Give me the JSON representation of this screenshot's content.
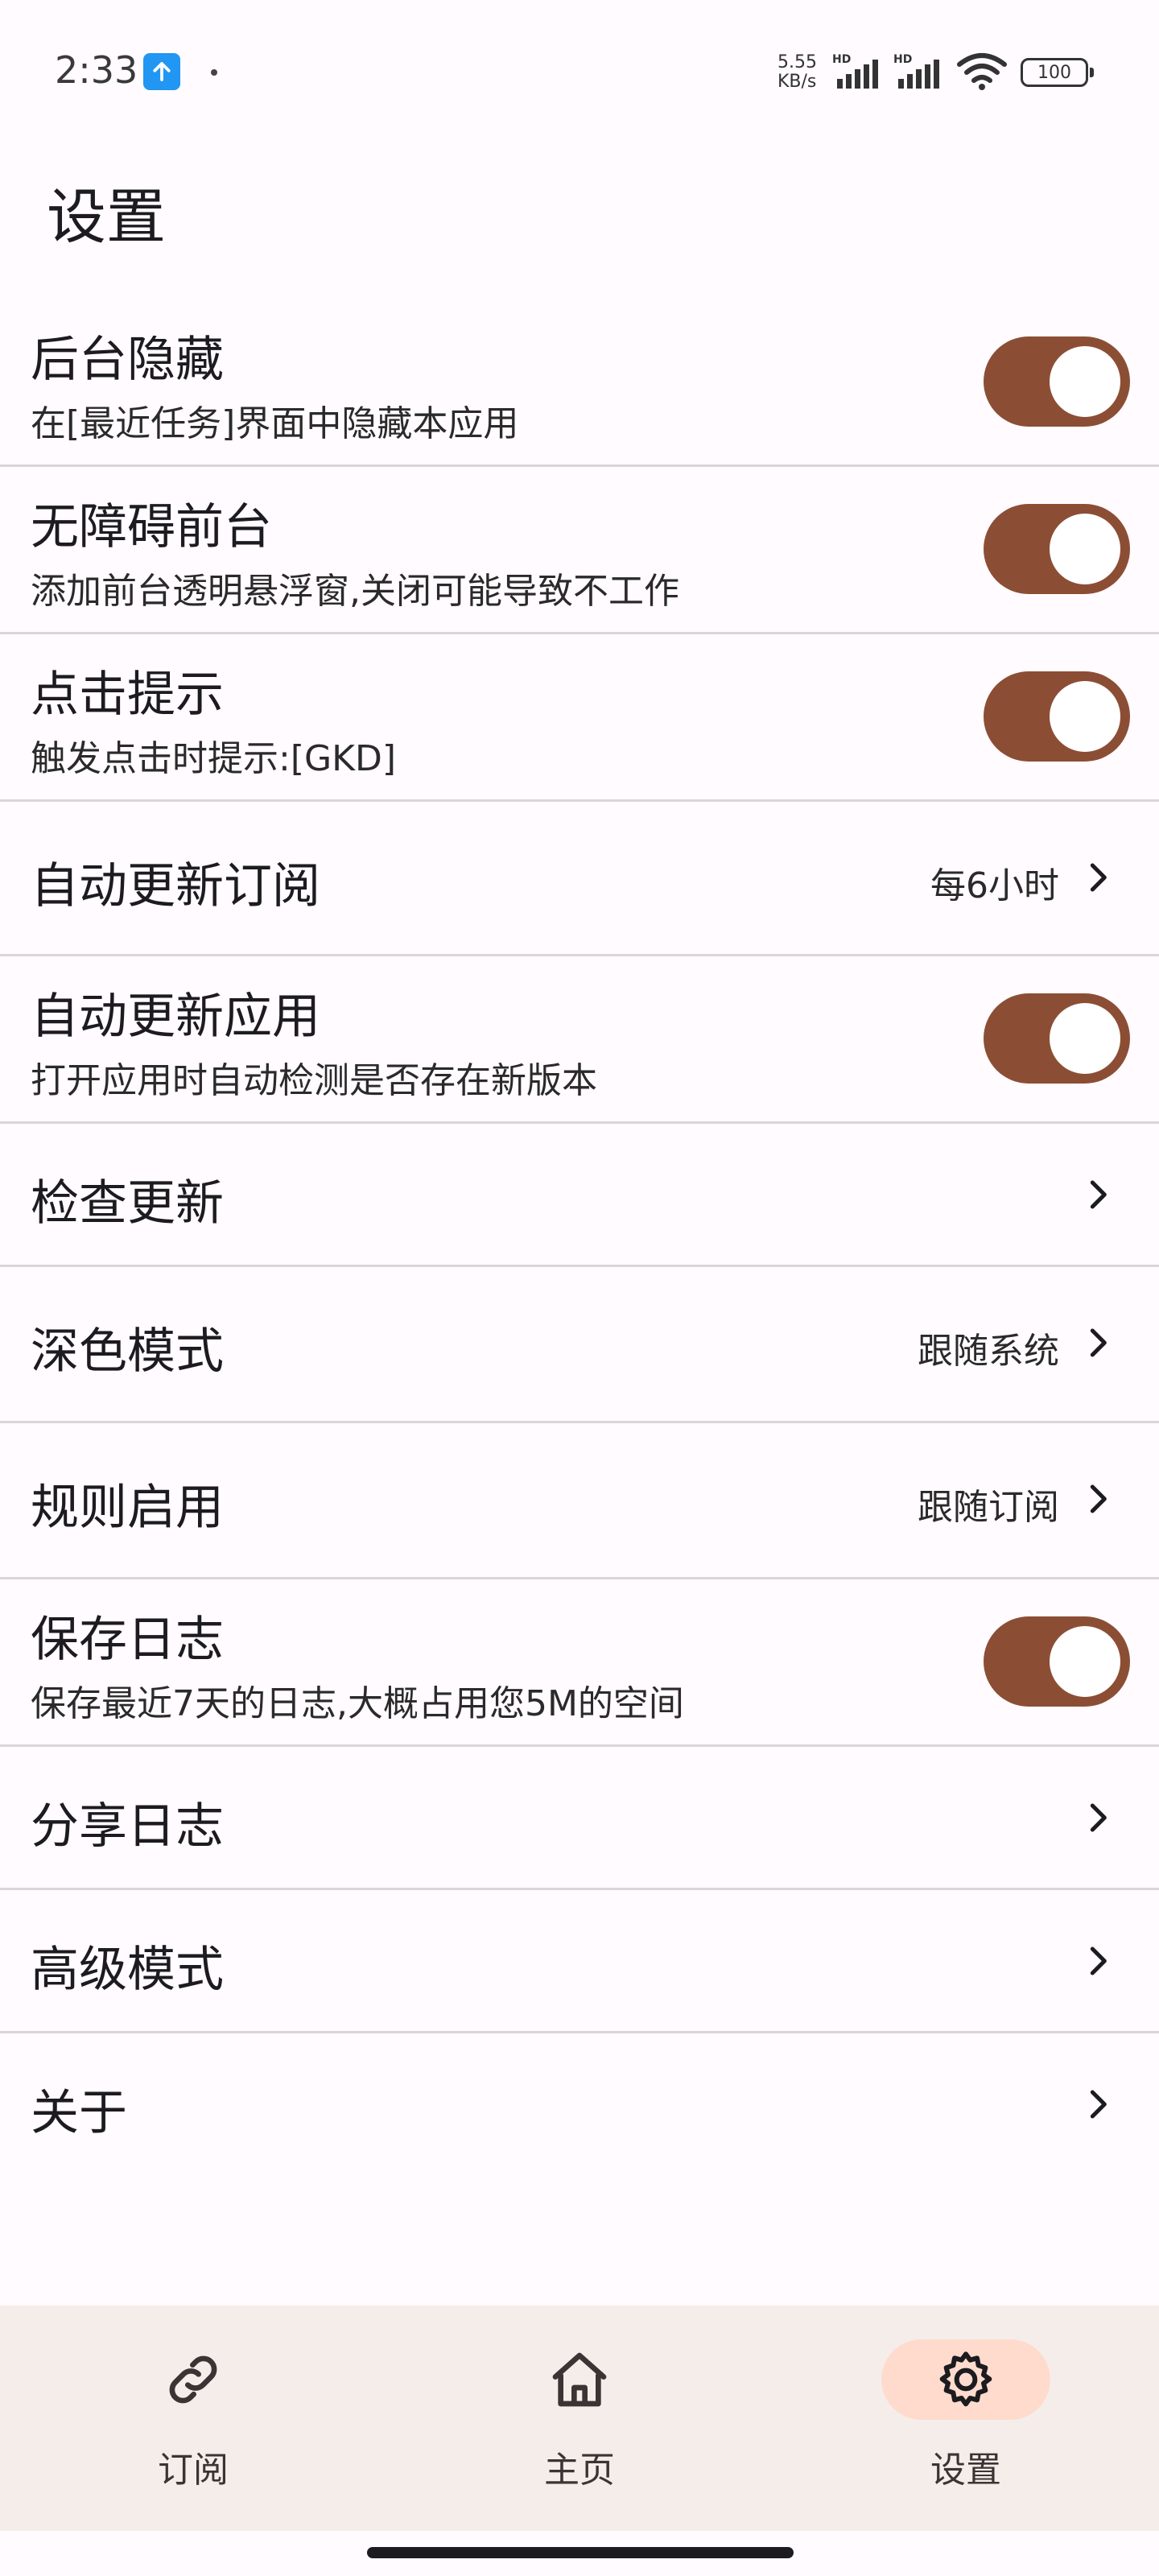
{
  "status_bar": {
    "time": "2:33",
    "speed_value": "5.55",
    "speed_unit": "KB/s",
    "sim1_badge": "HD",
    "sim2_badge": "HD",
    "battery": "100",
    "icons": [
      "upload-notification-icon",
      "signal-icon",
      "wifi-icon",
      "battery-icon"
    ]
  },
  "page": {
    "title": "设置"
  },
  "settings": [
    {
      "id": "hide-background",
      "title": "后台隐藏",
      "subtitle": "在[最近任务]界面中隐藏本应用",
      "type": "toggle",
      "on": true
    },
    {
      "id": "accessibility-foreground",
      "title": "无障碍前台",
      "subtitle": "添加前台透明悬浮窗,关闭可能导致不工作",
      "type": "toggle",
      "on": true
    },
    {
      "id": "click-tip",
      "title": "点击提示",
      "subtitle": "触发点击时提示:[GKD]",
      "type": "toggle",
      "on": true
    },
    {
      "id": "auto-update-subscription",
      "title": "自动更新订阅",
      "value": "每6小时",
      "type": "select"
    },
    {
      "id": "auto-update-app",
      "title": "自动更新应用",
      "subtitle": "打开应用时自动检测是否存在新版本",
      "type": "toggle",
      "on": true
    },
    {
      "id": "check-update",
      "title": "检查更新",
      "type": "link"
    },
    {
      "id": "dark-mode",
      "title": "深色模式",
      "value": "跟随系统",
      "type": "select"
    },
    {
      "id": "rule-enable",
      "title": "规则启用",
      "value": "跟随订阅",
      "type": "select"
    },
    {
      "id": "save-log",
      "title": "保存日志",
      "subtitle": "保存最近7天的日志,大概占用您5M的空间",
      "type": "toggle",
      "on": true
    },
    {
      "id": "share-log",
      "title": "分享日志",
      "type": "link"
    },
    {
      "id": "advanced-mode",
      "title": "高级模式",
      "type": "link"
    },
    {
      "id": "about",
      "title": "关于",
      "type": "link"
    }
  ],
  "bottom_nav": {
    "items": [
      {
        "label": "订阅",
        "icon": "link-icon",
        "active": false
      },
      {
        "label": "主页",
        "icon": "home-icon",
        "active": true
      },
      {
        "label": "设置",
        "icon": "gear-icon",
        "active": true
      }
    ]
  },
  "colors": {
    "background": "#FFFBFE",
    "toggle_on": "#8B4E35",
    "nav_background": "#F5EDEA",
    "nav_active_pill": "#FFDBCD",
    "divider": "#D9D5D9"
  }
}
